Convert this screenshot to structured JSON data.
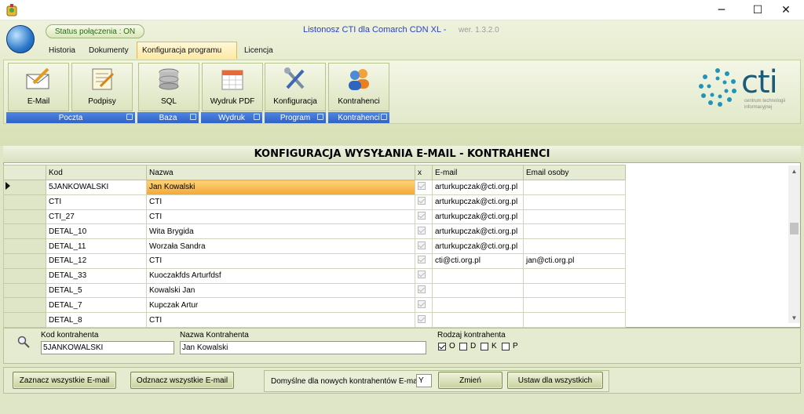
{
  "header": {
    "status": "Status połączenia : ON",
    "app_title": "Listonosz CTI dla Comarch CDN XL -",
    "version": "wer. 1.3.2.0"
  },
  "tabs": [
    "Historia",
    "Dokumenty",
    "Konfiguracja programu",
    "Licencja"
  ],
  "ribbon": {
    "buttons": [
      "E-Mail",
      "Podpisy",
      "SQL",
      "Wydruk PDF",
      "Konfiguracja",
      "Kontrahenci"
    ],
    "groups": [
      "Poczta",
      "Baza",
      "Wydruk",
      "Program",
      "Kontrahenci"
    ]
  },
  "logo": {
    "text": "cti",
    "sub1": "centrum technologii",
    "sub2": "informacyjnej"
  },
  "section_title": "KONFIGURACJA WYSYŁANIA E-MAIL - KONTRAHENCI",
  "grid": {
    "columns": [
      "Kod",
      "Nazwa",
      "x",
      "E-mail",
      "Email osoby"
    ],
    "rows": [
      [
        "5JANKOWALSKI",
        "Jan Kowalski",
        "arturkupczak@cti.org.pl",
        ""
      ],
      [
        "CTI",
        "CTI",
        "arturkupczak@cti.org.pl",
        ""
      ],
      [
        "CTI_27",
        "CTI",
        "arturkupczak@cti.org.pl",
        ""
      ],
      [
        "DETAL_10",
        "Wita Brygida",
        "arturkupczak@cti.org.pl",
        ""
      ],
      [
        "DETAL_11",
        "Worzała Sandra",
        "arturkupczak@cti.org.pl",
        ""
      ],
      [
        "DETAL_12",
        "CTI",
        "cti@cti.org.pl",
        "jan@cti.org.pl"
      ],
      [
        "DETAL_33",
        "Kuoczakfds Arturfdsf",
        "",
        ""
      ],
      [
        "DETAL_5",
        "Kowalski Jan",
        "",
        ""
      ],
      [
        "DETAL_7",
        "Kupczak Artur",
        "",
        ""
      ],
      [
        "DETAL_8",
        "CTI",
        "",
        ""
      ]
    ]
  },
  "form": {
    "kod_label": "Kod kontrahenta",
    "kod_value": "5JANKOWALSKI",
    "nazwa_label": "Nazwa Kontrahenta",
    "nazwa_value": "Jan Kowalski",
    "rodzaj_label": "Rodzaj kontrahenta",
    "types": [
      "O",
      "D",
      "K",
      "P"
    ]
  },
  "actions": {
    "zaznacz": "Zaznacz wszystkie E-mail",
    "odznacz": "Odznacz wszystkie E-mail",
    "default_label": "Domyślne dla nowych kontrahentów E-mail:",
    "default_value": "Y",
    "zmien": "Zmień",
    "ustaw": "Ustaw dla wszystkich"
  }
}
